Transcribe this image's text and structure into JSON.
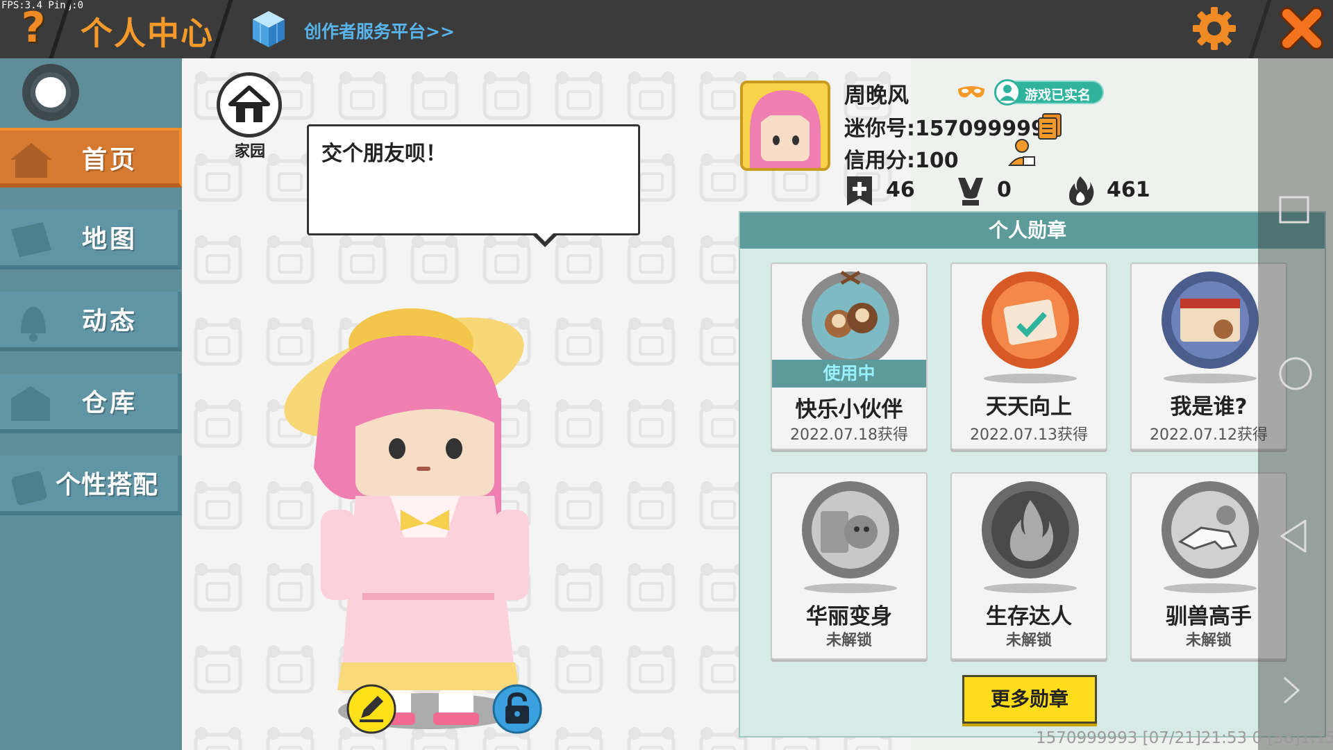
{
  "debug": {
    "fps_text": "FPS:3.4  Ping:0"
  },
  "header": {
    "help_icon": "question-mark-icon",
    "title": "个人中心",
    "creator_link": "创作者服务平台>>",
    "settings_icon": "gear-icon",
    "close_icon": "close-icon",
    "accent_color": "#f39a2b"
  },
  "sidebar": {
    "items": [
      {
        "label": "首页",
        "icon": "home-icon",
        "active": true
      },
      {
        "label": "地图",
        "icon": "map-icon",
        "active": false
      },
      {
        "label": "动态",
        "icon": "bell-icon",
        "active": false
      },
      {
        "label": "仓库",
        "icon": "warehouse-icon",
        "active": false
      },
      {
        "label": "个性搭配",
        "icon": "outfit-icon",
        "active": false
      }
    ]
  },
  "center": {
    "home_label": "家园",
    "speech_bubble": "交个朋友呗！",
    "edit_icon": "pencil-icon",
    "lock_icon": "lock-icon"
  },
  "profile": {
    "nickname": "周晚风",
    "realname_badge": "游戏已实名",
    "mini_id": "迷你号:1570999993",
    "credit": "信用分:100",
    "stats": [
      {
        "icon": "bookmark-plus-icon",
        "value": "46"
      },
      {
        "icon": "trophy-icon",
        "value": "0"
      },
      {
        "icon": "flame-icon",
        "value": "461"
      }
    ]
  },
  "medals": {
    "title": "个人勋章",
    "in_use_label": "使用中",
    "items": [
      {
        "name": "快乐小伙伴",
        "date": "2022.07.18获得",
        "in_use": true,
        "locked": false
      },
      {
        "name": "天天向上",
        "date": "2022.07.13获得",
        "in_use": false,
        "locked": false
      },
      {
        "name": "我是谁?",
        "date": "2022.07.12获得",
        "in_use": false,
        "locked": false
      },
      {
        "name": "华丽变身",
        "date": "未解锁",
        "in_use": false,
        "locked": true
      },
      {
        "name": "生存达人",
        "date": "未解锁",
        "in_use": false,
        "locked": true
      },
      {
        "name": "驯兽高手",
        "date": "未解锁",
        "in_use": false,
        "locked": true
      }
    ],
    "more_button": "更多勋章"
  },
  "footer": {
    "text": "1570999993   [07/21]21:53 0   [58]1.15.5"
  }
}
